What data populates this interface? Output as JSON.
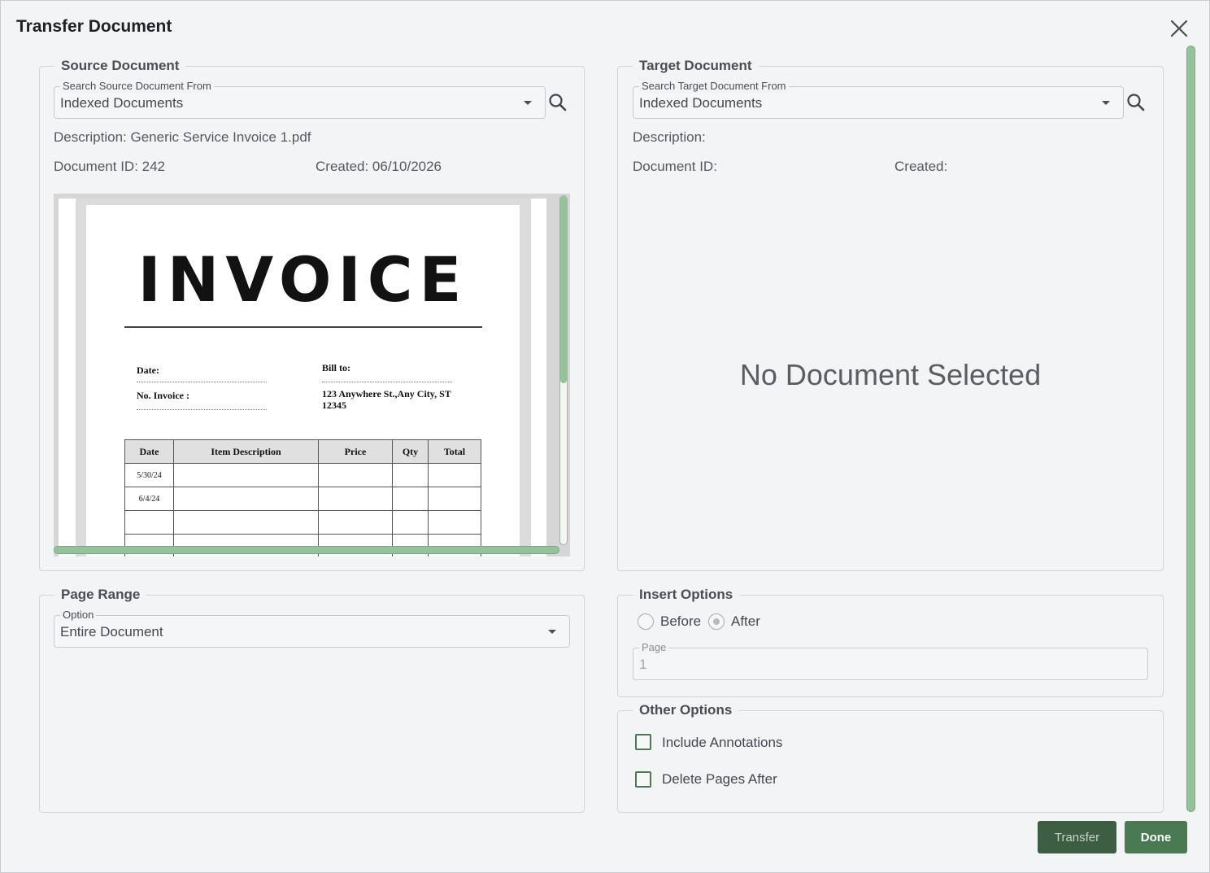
{
  "dialog": {
    "title": "Transfer Document"
  },
  "source": {
    "legend": "Source Document",
    "search_label": "Search Source Document From",
    "search_value": "Indexed Documents",
    "description": "Description: Generic Service Invoice 1.pdf",
    "document_id": "Document ID: 242",
    "created": "Created: 06/10/2026",
    "preview": {
      "title": "INVOICE",
      "date_label": "Date:",
      "no_invoice_label": "No. Invoice :",
      "bill_to_label": "Bill to:",
      "bill_to_address": "123 Anywhere St.,Any City, ST 12345",
      "table_headers": [
        "Date",
        "Item Description",
        "Price",
        "Qty",
        "Total"
      ],
      "table_rows": [
        [
          "5/30/24",
          "",
          "",
          "",
          ""
        ],
        [
          "6/4/24",
          "",
          "",
          "",
          ""
        ],
        [
          "",
          "",
          "",
          "",
          ""
        ],
        [
          "",
          "",
          "",
          "",
          ""
        ]
      ]
    }
  },
  "target": {
    "legend": "Target Document",
    "search_label": "Search Target Document From",
    "search_value": "Indexed Documents",
    "description": "Description:",
    "document_id": "Document ID:",
    "created": "Created:",
    "empty_message": "No Document Selected"
  },
  "page_range": {
    "legend": "Page Range",
    "option_label": "Option",
    "option_value": "Entire Document"
  },
  "insert_options": {
    "legend": "Insert Options",
    "before_label": "Before",
    "after_label": "After",
    "selected": "After",
    "page_label": "Page",
    "page_value": "1"
  },
  "other_options": {
    "legend": "Other Options",
    "include_annotations": "Include Annotations",
    "delete_pages_after": "Delete Pages After"
  },
  "buttons": {
    "transfer": "Transfer",
    "done": "Done"
  },
  "colors": {
    "accent_green": "#4a7a51",
    "scrollbar_green": "#94c39a",
    "background": "#f3f4f6"
  }
}
